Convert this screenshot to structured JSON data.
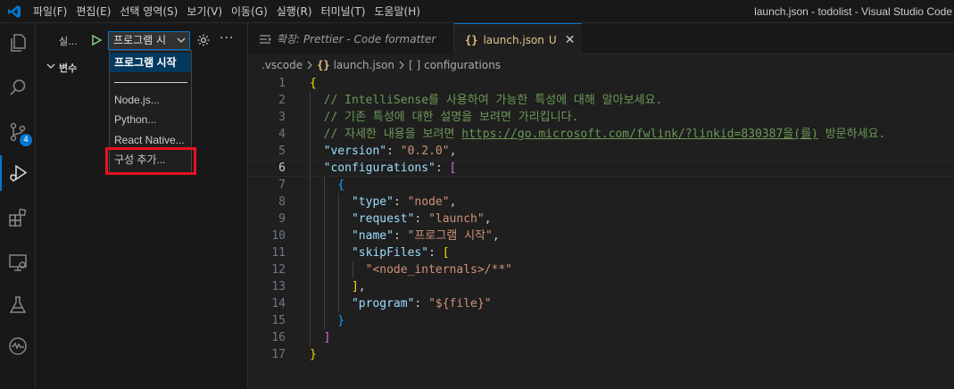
{
  "titlebar": {
    "menu": [
      "파일(F)",
      "편집(E)",
      "선택 영역(S)",
      "보기(V)",
      "이동(G)",
      "실행(R)",
      "터미널(T)",
      "도움말(H)"
    ],
    "window_title": "launch.json - todolist - Visual Studio Code"
  },
  "activitybar": {
    "icons": [
      "explorer-icon",
      "search-icon",
      "source-control-icon",
      "run-debug-icon",
      "extensions-icon",
      "remote-explorer-icon",
      "testing-icon",
      "timeline-icon"
    ],
    "source_control_badge": "4",
    "accent_color": "#0078d4"
  },
  "sidebar": {
    "title": "실...",
    "config_select_value": "프로그램 시",
    "variables_label": "변수"
  },
  "dropdown": {
    "items": [
      {
        "label": "프로그램 시작",
        "selected": true
      },
      {
        "label": "Node.js..."
      },
      {
        "label": "Python..."
      },
      {
        "label": "React Native..."
      },
      {
        "label": "구성 추가..."
      }
    ],
    "separator_label": "───────",
    "highlight_color": "#e81123"
  },
  "tabs": [
    {
      "label": "확장: Prettier - Code formatter",
      "icon": "extension-preview-icon"
    },
    {
      "label": "launch.json",
      "status": "U",
      "icon": "json-icon",
      "active": true
    }
  ],
  "breadcrumb": {
    "folder": ".vscode",
    "file": "launch.json",
    "symbol": "configurations",
    "symbol_prefix": "[ ]",
    "file_icon_text": "{}"
  },
  "editor": {
    "current_line": 6,
    "lines": [
      {
        "n": "1",
        "parts": [
          {
            "t": "{",
            "c": "c-brace1"
          }
        ]
      },
      {
        "n": "2",
        "parts": [
          {
            "t": "  // IntelliSense를 사용하여 가능한 특성에 대해 알아보세요.",
            "c": "c-comment"
          }
        ]
      },
      {
        "n": "3",
        "parts": [
          {
            "t": "  // 기존 특성에 대한 설명을 보려면 가리킵니다.",
            "c": "c-comment"
          }
        ]
      },
      {
        "n": "4",
        "parts": [
          {
            "t": "  // 자세한 내용을 보려면 ",
            "c": "c-comment"
          },
          {
            "t": "https://go.microsoft.com/fwlink/?linkid=830387을(를)",
            "c": "c-comment c-link"
          },
          {
            "t": " 방문하세요.",
            "c": "c-comment"
          }
        ]
      },
      {
        "n": "5",
        "parts": [
          {
            "t": "  ",
            "c": "c-punc"
          },
          {
            "t": "\"version\"",
            "c": "c-key"
          },
          {
            "t": ": ",
            "c": "c-punc"
          },
          {
            "t": "\"0.2.0\"",
            "c": "c-str"
          },
          {
            "t": ",",
            "c": "c-punc"
          }
        ]
      },
      {
        "n": "6",
        "parts": [
          {
            "t": "  ",
            "c": "c-punc"
          },
          {
            "t": "\"configurations\"",
            "c": "c-key"
          },
          {
            "t": ": ",
            "c": "c-punc"
          },
          {
            "t": "[",
            "c": "c-brace2"
          }
        ]
      },
      {
        "n": "7",
        "parts": [
          {
            "t": "    {",
            "c": "c-brace3"
          }
        ]
      },
      {
        "n": "8",
        "parts": [
          {
            "t": "      ",
            "c": "c-punc"
          },
          {
            "t": "\"type\"",
            "c": "c-key"
          },
          {
            "t": ": ",
            "c": "c-punc"
          },
          {
            "t": "\"node\"",
            "c": "c-str"
          },
          {
            "t": ",",
            "c": "c-punc"
          }
        ]
      },
      {
        "n": "9",
        "parts": [
          {
            "t": "      ",
            "c": "c-punc"
          },
          {
            "t": "\"request\"",
            "c": "c-key"
          },
          {
            "t": ": ",
            "c": "c-punc"
          },
          {
            "t": "\"launch\"",
            "c": "c-str"
          },
          {
            "t": ",",
            "c": "c-punc"
          }
        ]
      },
      {
        "n": "10",
        "parts": [
          {
            "t": "      ",
            "c": "c-punc"
          },
          {
            "t": "\"name\"",
            "c": "c-key"
          },
          {
            "t": ": ",
            "c": "c-punc"
          },
          {
            "t": "\"프로그램 시작\"",
            "c": "c-str"
          },
          {
            "t": ",",
            "c": "c-punc"
          }
        ]
      },
      {
        "n": "11",
        "parts": [
          {
            "t": "      ",
            "c": "c-punc"
          },
          {
            "t": "\"skipFiles\"",
            "c": "c-key"
          },
          {
            "t": ": ",
            "c": "c-punc"
          },
          {
            "t": "[",
            "c": "c-brace1"
          }
        ]
      },
      {
        "n": "12",
        "parts": [
          {
            "t": "        ",
            "c": "c-punc"
          },
          {
            "t": "\"<node_internals>/**\"",
            "c": "c-str"
          }
        ]
      },
      {
        "n": "13",
        "parts": [
          {
            "t": "      ]",
            "c": "c-brace1"
          },
          {
            "t": ",",
            "c": "c-punc"
          }
        ]
      },
      {
        "n": "14",
        "parts": [
          {
            "t": "      ",
            "c": "c-punc"
          },
          {
            "t": "\"program\"",
            "c": "c-key"
          },
          {
            "t": ": ",
            "c": "c-punc"
          },
          {
            "t": "\"${file}\"",
            "c": "c-str"
          }
        ]
      },
      {
        "n": "15",
        "parts": [
          {
            "t": "    }",
            "c": "c-brace3"
          }
        ]
      },
      {
        "n": "16",
        "parts": [
          {
            "t": "  ]",
            "c": "c-brace2"
          }
        ]
      },
      {
        "n": "17",
        "parts": [
          {
            "t": "}",
            "c": "c-brace1"
          }
        ]
      }
    ]
  }
}
